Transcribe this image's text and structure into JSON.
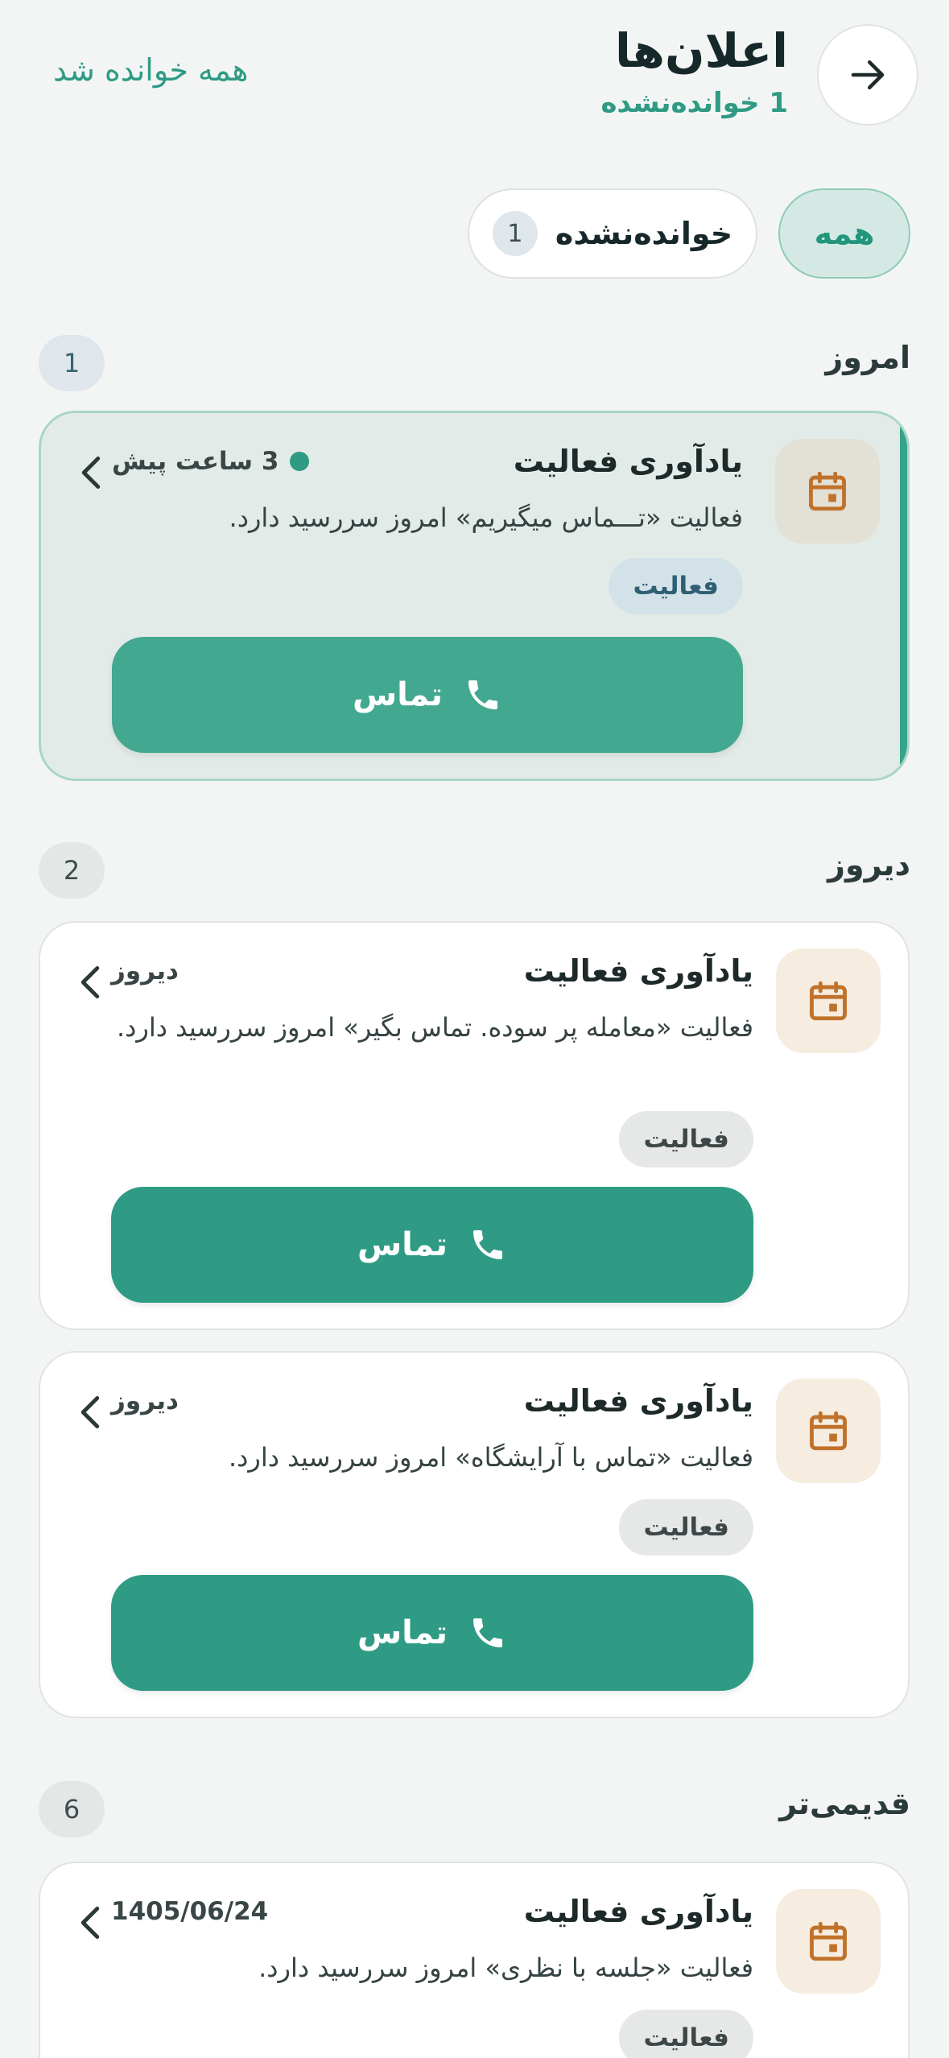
{
  "header": {
    "title": "اعلان‌ها",
    "subtitle": "1 خوانده‌نشده",
    "mark_all": "همه خوانده شد"
  },
  "tabs": [
    {
      "label": "همه",
      "active": true
    },
    {
      "label": "خوانده‌نشده",
      "count": "1",
      "active": false
    }
  ],
  "sections": [
    {
      "title": "امروز",
      "count": "1",
      "cards": [
        {
          "title": "یادآوری فعالیت",
          "time": "3 ساعت پیش",
          "unread": true,
          "body": "فعالیت «تـــماس میگیریم» امروز سررسید دارد.",
          "tag": "فعالیت",
          "action": "تماس"
        }
      ]
    },
    {
      "title": "دیروز",
      "count": "2",
      "cards": [
        {
          "title": "یادآوری فعالیت",
          "time": "دیروز",
          "unread": false,
          "body": "فعالیت «معامله پر سوده. تماس بگیر» امروز سررسید دارد.",
          "tag": "فعالیت",
          "action": "تماس"
        },
        {
          "title": "یادآوری فعالیت",
          "time": "دیروز",
          "unread": false,
          "body": "فعالیت «تماس با آرایشگاه» امروز سررسید دارد.",
          "tag": "فعالیت",
          "action": "تماس"
        }
      ]
    },
    {
      "title": "قدیمی‌تر",
      "count": "6",
      "cards": [
        {
          "title": "یادآوری فعالیت",
          "time": "1405/06/24",
          "unread": false,
          "body": "فعالیت «جلسه با نظری» امروز سررسید دارد.",
          "tag": "فعالیت"
        }
      ]
    }
  ],
  "colors": {
    "accent": "#2f9b84",
    "calendar_icon": "#c0722a"
  },
  "icons": {
    "back": "arrow-right-icon",
    "card": "calendar-icon",
    "chevron": "chevron-left-icon",
    "call": "phone-icon"
  }
}
